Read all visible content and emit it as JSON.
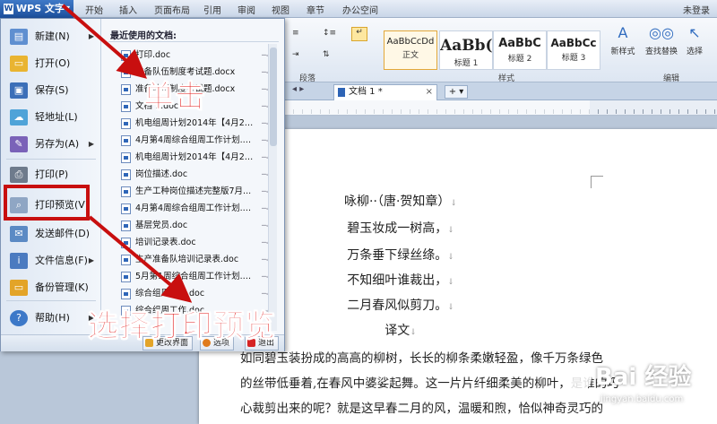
{
  "app": {
    "wps_button_label": "WPS 文字",
    "tabs": [
      "开始",
      "插入",
      "页面布局",
      "引用",
      "审阅",
      "视图",
      "章节",
      "办公空间"
    ],
    "user_status": "未登录"
  },
  "ribbon": {
    "styles": [
      {
        "sample": "AaBbCcDd",
        "name": "正文"
      },
      {
        "sample": "AaBb(",
        "name": "标题 1"
      },
      {
        "sample": "AaBbC",
        "name": "标题 2"
      },
      {
        "sample": "AaBbCc",
        "name": "标题 3"
      }
    ],
    "new_style_label": "新样式",
    "find_replace_label": "查找替换",
    "select_label": "选择",
    "groups": {
      "paragraph": "段落",
      "styles": "样式",
      "edit": "编辑"
    }
  },
  "document_tab": {
    "title": "文档 1 *",
    "new_tab_label": "+"
  },
  "menu": {
    "items": [
      {
        "label": "新建(N)",
        "has_arrow": true
      },
      {
        "label": "打开(O)",
        "has_arrow": false
      },
      {
        "label": "保存(S)",
        "has_arrow": false
      },
      {
        "label": "轻地址(L)",
        "has_arrow": false
      },
      {
        "label": "另存为(A)",
        "has_arrow": true
      },
      {
        "label": "打印(P)",
        "has_arrow": false
      },
      {
        "label": "打印预览(V)",
        "has_arrow": false
      },
      {
        "label": "发送邮件(D)",
        "has_arrow": false
      },
      {
        "label": "文件信息(F)",
        "has_arrow": true
      },
      {
        "label": "备份管理(K)",
        "has_arrow": false
      },
      {
        "label": "帮助(H)",
        "has_arrow": true
      }
    ],
    "recent_title": "最近使用的文档:",
    "recent_docs": [
      "打印.doc",
      "准备队伍制度考试题.docx",
      "准备队伍制度考试题.docx",
      "文档 1.doc",
      "机电组周计划2014年【4月21...",
      "4月第4周综合组周工作计划.d...",
      "机电组周计划2014年【4月21...",
      "岗位描述.doc",
      "生产工种岗位描述完整版7月...",
      "4月第4周综合组周工作计划.d...",
      "基层党员.doc",
      "培训记录表.doc",
      "生产准备队培训记录表.doc",
      "5月第1周综合组周工作计划.d...",
      "综合组周工作.doc",
      "综合组周工作.doc"
    ],
    "bottom_buttons": {
      "change_ui": "更改界面",
      "options": "选项",
      "exit": "退出"
    }
  },
  "document": {
    "poem": [
      "咏柳··（唐·贺知章）",
      "碧玉妆成一树高，",
      "万条垂下绿丝绦。",
      "不知细叶谁裁出，",
      "二月春风似剪刀。",
      "译文"
    ],
    "paragraph": [
      "如同碧玉装扮成的高高的柳树，长长的柳条柔嫩轻盈，像千万条绿色",
      "的丝带低垂着,在春风中婆娑起舞。这一片片纤细柔美的柳叶，是谁的巧",
      "心裁剪出来的呢？就是这早春二月的风，温暖和煦，恰似神奇灵巧的"
    ]
  },
  "annotations": {
    "callout_click": "单击",
    "callout_select": "选择打印预览",
    "highlight_color": "#c80f0f",
    "text_color": "#e01010"
  },
  "watermark": {
    "text": "Bai 经验",
    "url": "jingyan.baidu.com"
  }
}
